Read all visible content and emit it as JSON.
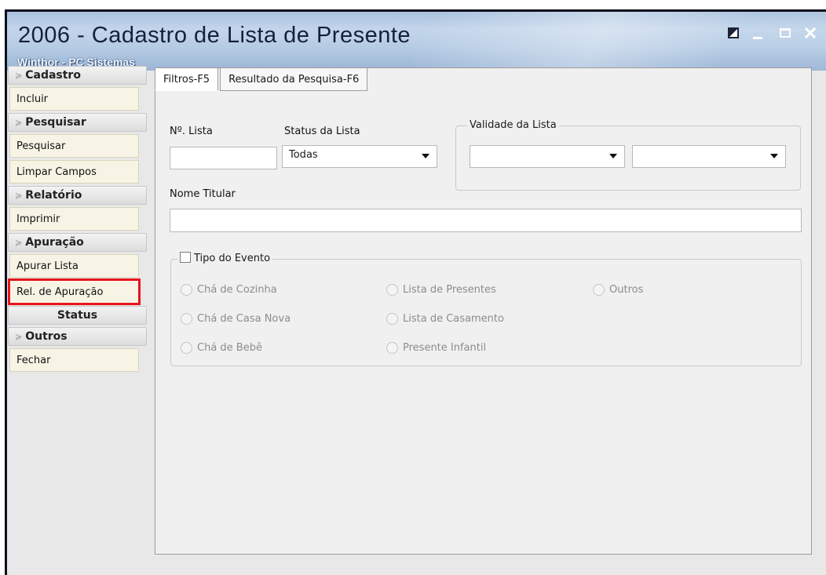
{
  "window": {
    "title": "2006 - Cadastro de Lista de Presente",
    "subtitle": "Winthor - PC Sistemas"
  },
  "sidebar": {
    "groups": [
      {
        "label": "Cadastro",
        "items": [
          "Incluir"
        ]
      },
      {
        "label": "Pesquisar",
        "items": [
          "Pesquisar",
          "Limpar Campos"
        ]
      },
      {
        "label": "Relatório",
        "items": [
          "Imprimir"
        ]
      },
      {
        "label": "Apuração",
        "items": [
          "Apurar Lista",
          "Rel. de Apuração"
        ]
      },
      {
        "label": "Status",
        "items": []
      },
      {
        "label": "Outros",
        "items": [
          "Fechar"
        ]
      }
    ],
    "highlighted_item": "Rel. de Apuração",
    "highlight_color": "#e8141c"
  },
  "tabs": [
    {
      "label": "Filtros-F5",
      "active": true
    },
    {
      "label": "Resultado da Pesquisa-F6",
      "active": false
    }
  ],
  "filters": {
    "numero_lista_label": "Nº. Lista",
    "numero_lista_value": "",
    "status_label": "Status da Lista",
    "status_value": "Todas",
    "validade_label": "Validade da Lista",
    "validade_from": "",
    "validade_to": "",
    "nome_titular_label": "Nome Titular",
    "nome_titular_value": "",
    "tipo_evento_label": "Tipo do Evento",
    "tipo_evento_checked": false,
    "tipo_evento_options": [
      "Chá de Cozinha",
      "Lista de Presentes",
      "Outros",
      "Chá de Casa Nova",
      "Lista de Casamento",
      "Chá de Bebê",
      "Presente Infantil"
    ]
  }
}
